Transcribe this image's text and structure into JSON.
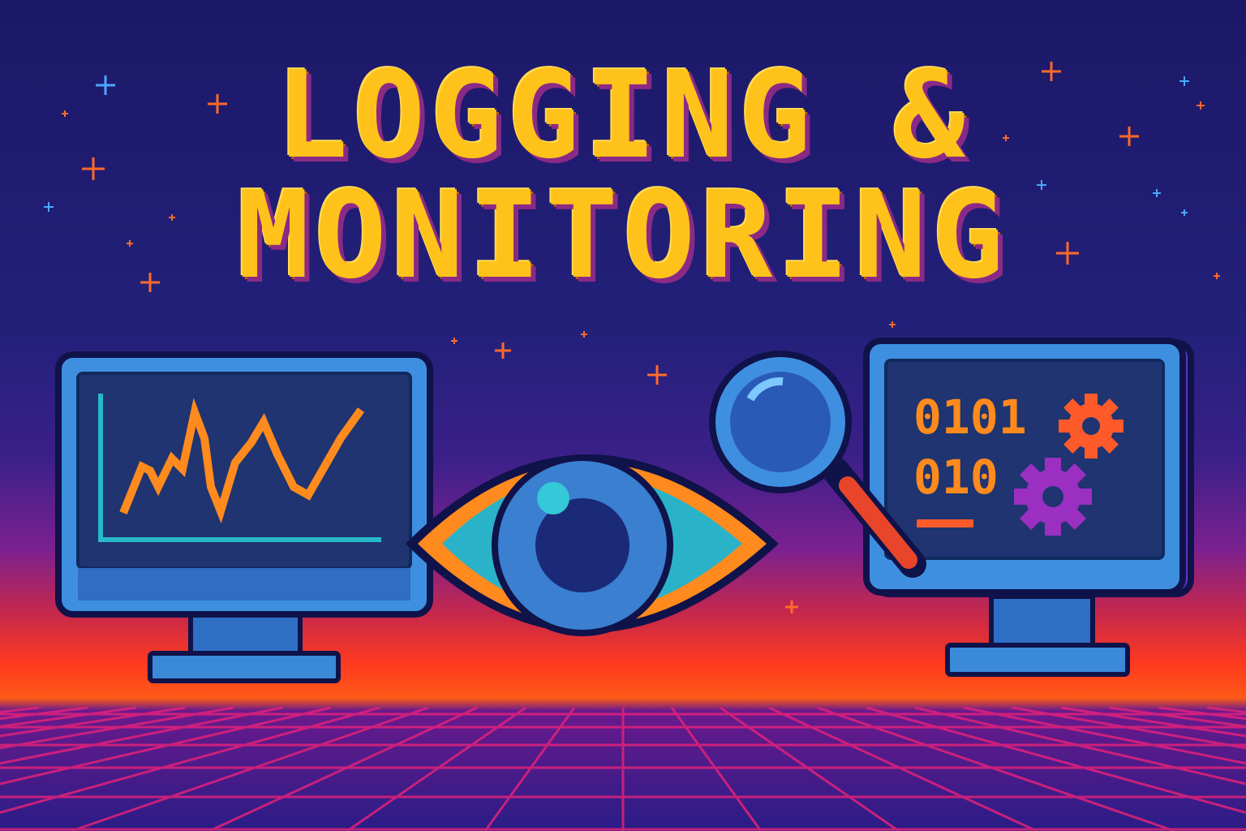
{
  "title": {
    "line1": "LOGGING &",
    "line2": "MONITORING"
  },
  "right_monitor": {
    "binary_line1": "0101",
    "binary_line2": "010"
  },
  "icons": [
    "line-chart-icon",
    "eye-icon",
    "magnifying-glass-icon",
    "binary-code-icon",
    "gear-icon"
  ],
  "colors": {
    "sky_top": "#1e1a6e",
    "horizon": "#ff4a1c",
    "title": "#ffc21a",
    "monitor_frame": "#3a7fd0",
    "screen": "#1f3470",
    "accent_orange": "#ff8a1e",
    "gear_purple": "#9b2fc2",
    "grid": "#e0227a"
  }
}
